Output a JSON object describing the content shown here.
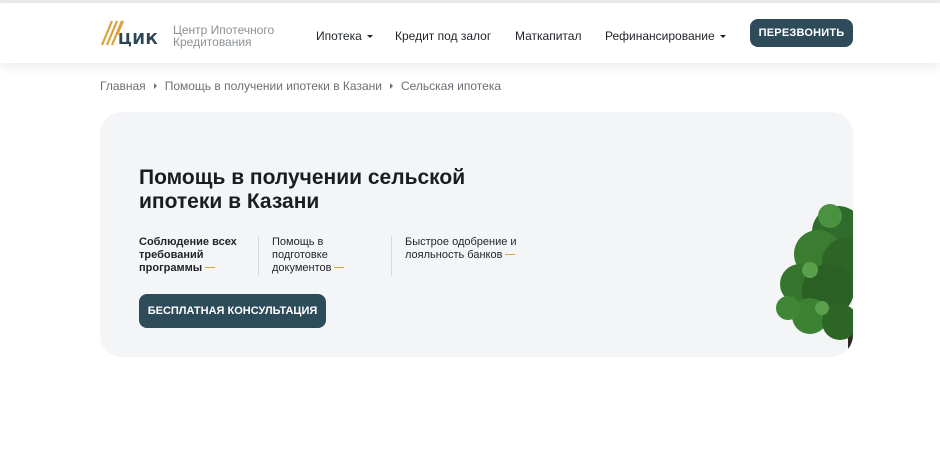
{
  "header": {
    "logo_text": "ЦИК",
    "brand_line1": "Центр Ипотечного",
    "brand_line2": "Кредитования",
    "nav": [
      {
        "label": "Ипотека",
        "has_dropdown": true
      },
      {
        "label": "Кредит под залог",
        "has_dropdown": false
      },
      {
        "label": "Маткапитал",
        "has_dropdown": false
      },
      {
        "label": "Рефинансирование",
        "has_dropdown": true
      }
    ],
    "call_button": "ПЕРЕЗВОНИТЬ"
  },
  "breadcrumb": [
    "Главная",
    "Помощь в получении ипотеки в Казани",
    "Сельская ипотека"
  ],
  "hero": {
    "title": "Помощь в получении сельской ипотеки в Казани",
    "features": [
      {
        "lines": [
          "Соблюдение всех",
          "требований",
          "программы"
        ],
        "bold": true
      },
      {
        "lines": [
          "Помощь в",
          "подготовке",
          "документов"
        ],
        "bold": false
      },
      {
        "lines": [
          "Быстрое одобрение и",
          "лояльность банков"
        ],
        "bold": false
      }
    ],
    "consult_button": "БЕСПЛАТНАЯ КОНСУЛЬТАЦИЯ",
    "image_icon": "tree-icon"
  },
  "colors": {
    "accent": "#2e4b5a",
    "gold": "#d9a23a",
    "hero_bg": "#f4f5f7"
  }
}
